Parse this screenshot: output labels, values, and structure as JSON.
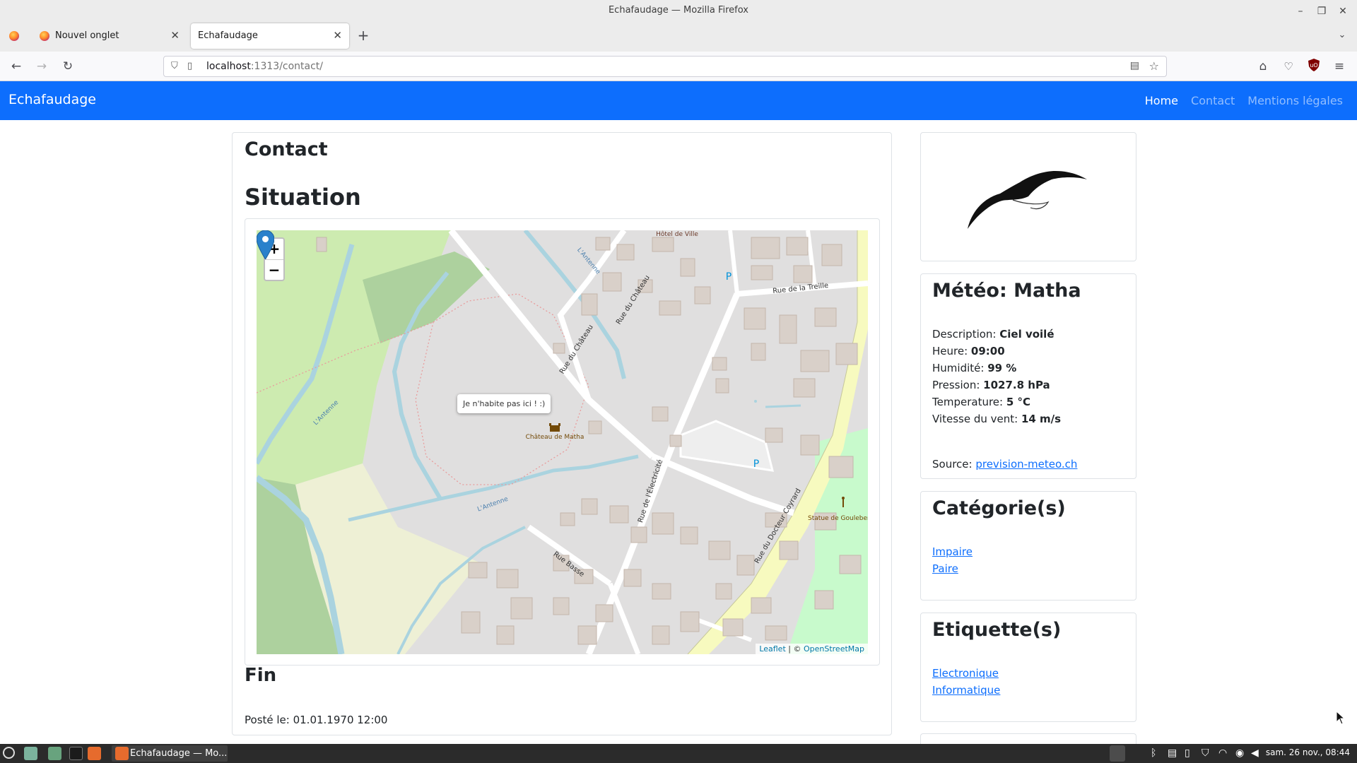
{
  "window": {
    "title": "Echafaudage — Mozilla Firefox"
  },
  "tabs": [
    {
      "label": "Nouvel onglet"
    },
    {
      "label": "Echafaudage"
    }
  ],
  "urlbar": {
    "host": "localhost",
    "rest": ":1313/contact/"
  },
  "site": {
    "brand": "Echafaudage",
    "nav": {
      "home": "Home",
      "contact": "Contact",
      "legal": "Mentions légales"
    }
  },
  "main": {
    "heading": "Contact",
    "section": "Situation",
    "map": {
      "zoom_in": "+",
      "zoom_out": "−",
      "popup": "Je n'habite pas ici ! :)",
      "attribution": {
        "leaflet": "Leaflet",
        "sep": " | © ",
        "osm": "OpenStreetMap"
      },
      "labels": {
        "hotel": "Hôtel de Ville",
        "chateau1": "Rue du Château",
        "chateau2": "Rue du Château",
        "treille": "Rue de la Treille",
        "electricite": "Rue de l'Électricité",
        "basse": "Rue Basse",
        "coyrard": "Rue du Docteur Coyrard",
        "castle": "Château de Matha",
        "statue": "Statue de Goulebenéz",
        "antenne": "L'Antenne",
        "parking": "P"
      }
    },
    "footer_heading": "Fin",
    "posted": "Posté le: 01.01.1970 12:00"
  },
  "weather": {
    "title": "Météo: Matha",
    "rows": [
      {
        "label": "Description: ",
        "value": "Ciel voilé"
      },
      {
        "label": "Heure: ",
        "value": "09:00"
      },
      {
        "label": "Humidité: ",
        "value": "99 %"
      },
      {
        "label": "Pression: ",
        "value": "1027.8 hPa"
      },
      {
        "label": "Temperature: ",
        "value": "5 °C"
      },
      {
        "label": "Vitesse du vent: ",
        "value": "14 m/s"
      }
    ],
    "source_label": "Source: ",
    "source_link": "prevision-meteo.ch"
  },
  "categories": {
    "title": "Catégorie(s)",
    "items": [
      "Impaire",
      "Paire"
    ]
  },
  "tags": {
    "title": "Etiquette(s)",
    "items": [
      "Electronique",
      "Informatique"
    ]
  },
  "taskbar": {
    "task_label": "Echafaudage — Mo...",
    "clock": "sam. 26 nov., 08:44"
  },
  "colors": {
    "brand": "#0d6efd",
    "link": "#0d6efd",
    "taskbar": "#2b2b2b"
  }
}
